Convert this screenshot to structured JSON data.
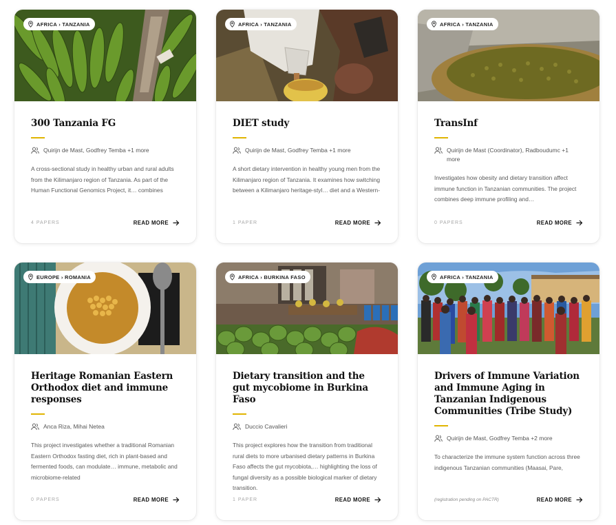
{
  "cards": [
    {
      "location": "AFRICA › TANZANIA",
      "title": "300 Tanzania FG",
      "authors": "Quirijn de Mast, Godfrey Temba +1 more",
      "description": "A cross-sectional study in healthy urban and rural adults from the Kilimanjaro region of Tanzania. As part of the Human Functional Genomics Project, it… combines functional immune assays with multi-",
      "papers": "4 PAPERS",
      "read_more": "READ MORE"
    },
    {
      "location": "AFRICA › TANZANIA",
      "title": "DIET study",
      "authors": "Quirijn de Mast, Godfrey Temba +1 more",
      "description": "A short dietary intervention in healthy young men from the Kilimanjaro region of Tanzania. It examines how switching between a Kilimanjaro heritage-styl… diet and a Western-style diet, or consuming a",
      "papers": "1 PAPER",
      "read_more": "READ MORE"
    },
    {
      "location": "AFRICA › TANZANIA",
      "title": "TransInf",
      "authors": "Quirijn de Mast (Coordinator), Radboudumc +1 more",
      "description": "Investigates how obesity and dietary transition affect immune function in Tanzanian communities. The project combines deep immune profiling and…",
      "papers": "0 PAPERS",
      "read_more": "READ MORE"
    },
    {
      "location": "EUROPE › ROMANIA",
      "title": "Heritage Romanian Eastern Orthodox diet and immune responses",
      "authors": "Anca Riza, Mihai Netea",
      "description": "This project investigates whether a traditional Romanian Eastern Orthodox fasting diet, rich in plant-based and fermented foods, can modulate… immune, metabolic and microbiome-related",
      "papers": "0 PAPERS",
      "read_more": "READ MORE"
    },
    {
      "location": "AFRICA › BURKINA FASO",
      "title": "Dietary transition and the gut mycobiome in Burkina Faso",
      "authors": "Duccio Cavalieri",
      "description": "This project explores how the transition from traditional rural diets to more urbanised dietary patterns in Burkina Faso affects the gut mycobiota,… highlighting the loss of fungal diversity as a possible biological marker of dietary transition.",
      "papers": "1 PAPER",
      "read_more": "READ MORE"
    },
    {
      "location": "AFRICA › TANZANIA",
      "title": "Drivers of Immune Variation and Immune Aging in Tanzanian Indigenous Communities (Tribe Study)",
      "authors": "Quirijn de Mast, Godfrey Temba +2 more",
      "description": "To characterize the immune system function across three indigenous Tanzanian communities (Maasai, Pare, Chagga), including estimation of immune…",
      "papers": "(registration pending on PACTR)",
      "read_more": "READ MORE"
    }
  ],
  "icons": {
    "location": "map-pin-icon",
    "authors": "users-icon",
    "read_more": "arrow-right-icon"
  },
  "colors": {
    "accent": "#e0b400"
  }
}
